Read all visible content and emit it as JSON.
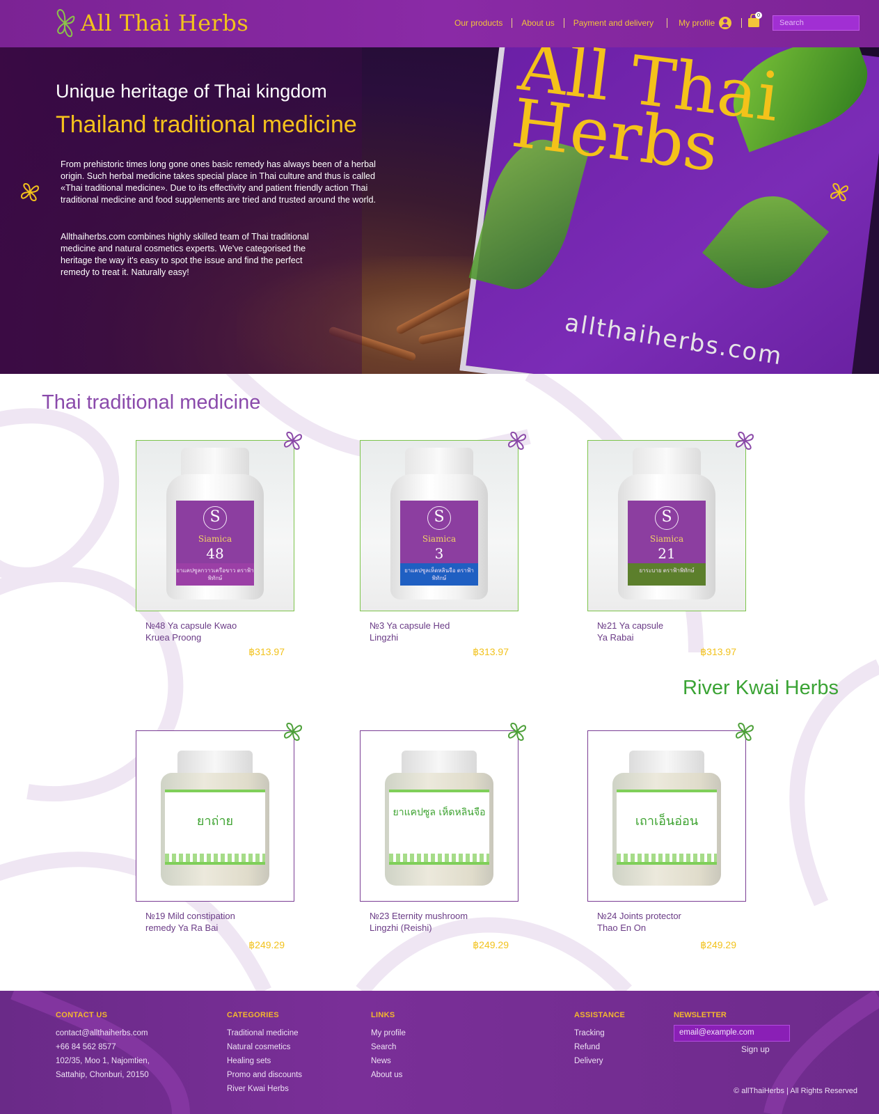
{
  "header": {
    "logo_text": "All Thai Herbs",
    "nav": [
      {
        "label": "Our products"
      },
      {
        "label": "About us"
      },
      {
        "label": "Payment and delivery"
      }
    ],
    "profile_label": "My profile",
    "cart_count": "0",
    "search_placeholder": "Search"
  },
  "hero": {
    "subtitle": "Unique heritage of Thai kingdom",
    "title": "Thailand traditional medicine",
    "paragraph1": "From prehistoric times long gone ones basic remedy has always been of a herbal origin. Such herbal medicine takes special place in Thai culture and thus is called «Thai traditional medicine». Due to its effectivity and patient friendly action Thai traditional medicine and food supplements are tried and trusted around the world.",
    "paragraph2": "Allthaiherbs.com combines highly skilled team of Thai traditional medicine and natural cosmetics experts. We've categorised the heritage  the way it's easy to spot the issue and find the perfect remedy to treat it. Naturally easy!",
    "card_text": "All Thai Herbs",
    "card_url": "allthaiherbs.com"
  },
  "sections": [
    {
      "title": "Thai traditional medicine",
      "products": [
        {
          "name": "№48 Ya capsule Kwao Kruea Proong",
          "price": "฿313.97",
          "label_brand": "Siamica",
          "label_number": "48",
          "band_text": "ยาแคปซูลกวาวเครือขาว ตราฟ้าพิทักษ์",
          "band_color": "#9b3fa6"
        },
        {
          "name": "№3 Ya capsule Hed Lingzhi",
          "price": "฿313.97",
          "label_brand": "Siamica",
          "label_number": "3",
          "band_text": "ยาแคปซูลเห็ดหลินจือ ตราฟ้าพิทักษ์",
          "band_color": "#1f5fc2"
        },
        {
          "name": "№21 Ya capsule Ya Rabai",
          "price": "฿313.97",
          "label_brand": "Siamica",
          "label_number": "21",
          "band_text": "ยาระบาย ตราฟ้าพิทักษ์",
          "band_color": "#5c7f2c"
        }
      ]
    },
    {
      "title": "River Kwai Herbs",
      "products": [
        {
          "name": "№19 Mild constipation remedy Ya Ra Bai",
          "price": "฿249.29",
          "jar_text": "ยาถ่าย"
        },
        {
          "name": "№23 Eternity mushroom Lingzhi (Reishi)",
          "price": "฿249.29",
          "jar_text": "ยาแคปซูล เห็ดหลินจือ"
        },
        {
          "name": "№24 Joints protector Thao En On",
          "price": "฿249.29",
          "jar_text": "เถาเอ็นอ่อน"
        }
      ]
    }
  ],
  "footer": {
    "contact": {
      "heading": "CONTACT US",
      "email": "contact@allthaiherbs.com",
      "phone": "+66 84 562 8577",
      "address1": "102/35, Moo 1, Najomtien,",
      "address2": "Sattahip, Chonburi, 20150"
    },
    "categories": {
      "heading": "CATEGORIES",
      "items": [
        "Traditional medicine",
        "Natural cosmetics",
        "Healing sets",
        "Promo and discounts",
        "River Kwai Herbs"
      ]
    },
    "links": {
      "heading": "LINKS",
      "items": [
        "My profile",
        "Search",
        "News",
        "About us"
      ]
    },
    "assistance": {
      "heading": "ASSISTANCE",
      "items": [
        "Tracking",
        "Refund",
        "Delivery"
      ]
    },
    "newsletter": {
      "heading": "NEWSLETTER",
      "email_placeholder": "email@example.com",
      "signup_label": "Sign up"
    },
    "copyright": "© allThaiHerbs | All Rights Reserved"
  },
  "colors": {
    "brand_purple": "#8a2aa6",
    "accent_gold": "#f2c21c",
    "green": "#3aa334"
  },
  "icons": [
    "logo-flower-icon",
    "profile-icon",
    "cart-icon",
    "flower-icon"
  ]
}
